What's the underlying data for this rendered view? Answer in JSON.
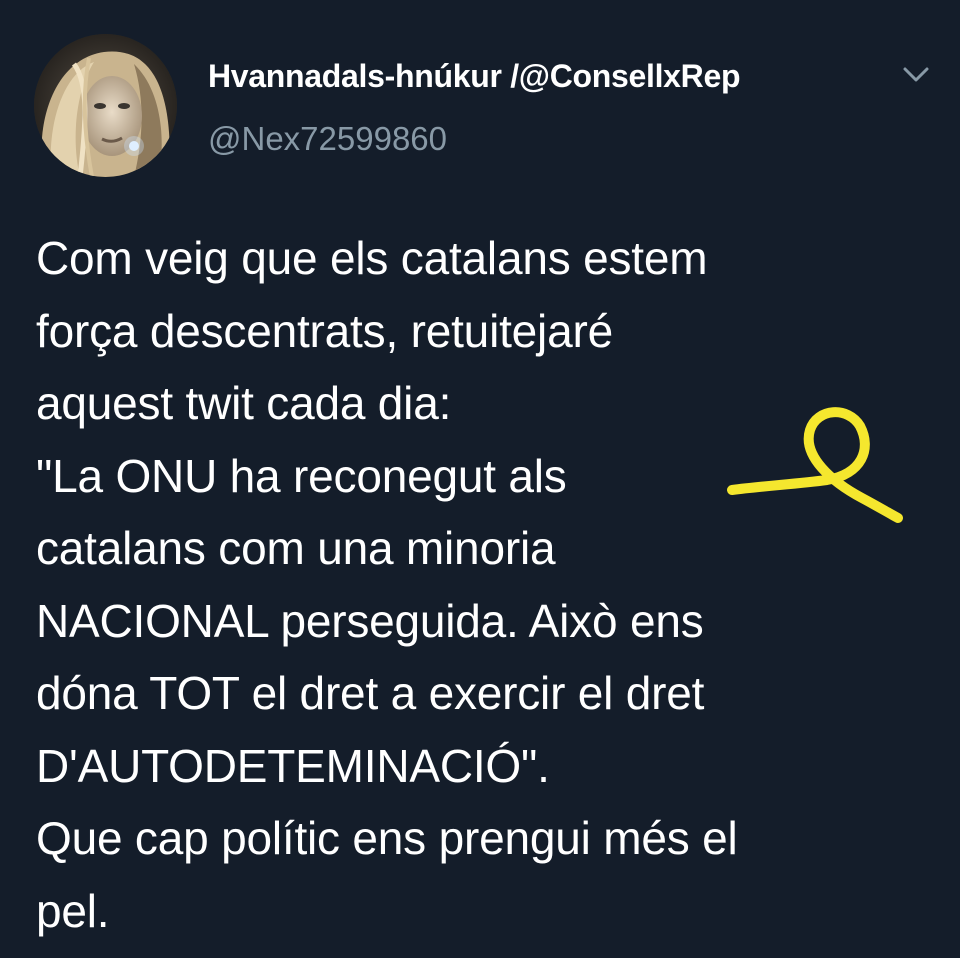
{
  "tweet": {
    "author": {
      "display_name": "Hvannadals-hnúkur /@ConsellxRep",
      "handle": "@Nex72599860"
    },
    "menu_icon": "chevron-down-icon",
    "body_lines": [
      "Com veig que els catalans estem",
      "força descentrats, retuitejaré",
      "aquest twit cada dia:",
      "\"La ONU ha reconegut als",
      "catalans com una minoria",
      "NACIONAL perseguida. Això ens",
      "dóna TOT el dret a exercir el dret",
      "D'AUTODETEMINACIÓ\".",
      "Que cap polític ens prengui més el",
      "pel."
    ],
    "annotation": {
      "icon": "yellow-ribbon-icon",
      "color": "#f5e72e"
    }
  },
  "colors": {
    "background": "#141d2a",
    "text": "#ffffff",
    "secondary_text": "#8899a6"
  }
}
